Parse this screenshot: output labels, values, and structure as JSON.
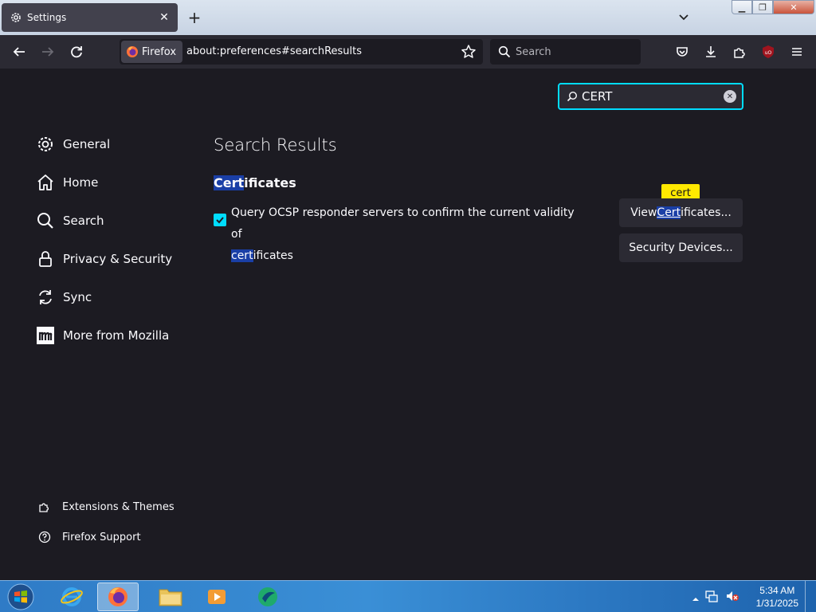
{
  "tab": {
    "title": "Settings"
  },
  "urlbar": {
    "identity_label": "Firefox",
    "url": "about:preferences#searchResults"
  },
  "searchbar": {
    "placeholder": "Search"
  },
  "find": {
    "value": "CERT"
  },
  "sidebar": {
    "items": [
      {
        "label": "General",
        "icon": "gear-icon"
      },
      {
        "label": "Home",
        "icon": "home-icon"
      },
      {
        "label": "Search",
        "icon": "search-icon"
      },
      {
        "label": "Privacy & Security",
        "icon": "lock-icon"
      },
      {
        "label": "Sync",
        "icon": "sync-icon"
      },
      {
        "label": "More from Mozilla",
        "icon": "mozilla-icon"
      }
    ],
    "footer": [
      {
        "label": "Extensions & Themes",
        "icon": "puzzle-icon"
      },
      {
        "label": "Firefox Support",
        "icon": "help-icon"
      }
    ]
  },
  "main": {
    "title": "Search Results",
    "section_heading_hl": "Cert",
    "section_heading_rest": "ificates",
    "ocsp_text": "Query OCSP responder servers to confirm the current validity of",
    "ocsp_hl": "cert",
    "ocsp_rest": "ificates",
    "ocsp_checked": true,
    "view_certs_pre": "View ",
    "view_certs_hl": "Cert",
    "view_certs_rest": "ificates...",
    "tooltip": "cert",
    "security_devices": "Security Devices..."
  },
  "taskbar": {
    "time": "5:34 AM",
    "date": "1/31/2025"
  },
  "colors": {
    "accent": "#00ddff",
    "highlight": "#1a3fa6",
    "tooltip": "#ffe900"
  }
}
